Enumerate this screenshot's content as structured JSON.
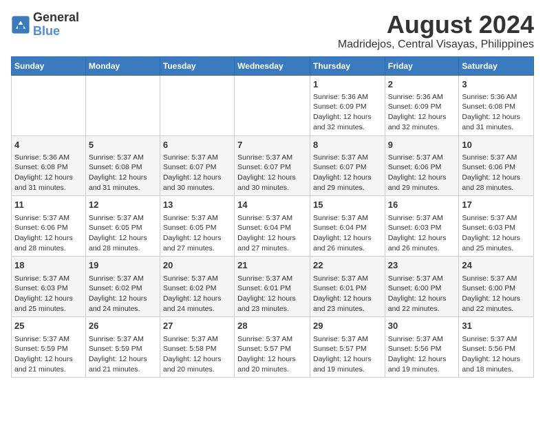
{
  "logo": {
    "line1": "General",
    "line2": "Blue"
  },
  "title": "August 2024",
  "subtitle": "Madridejos, Central Visayas, Philippines",
  "weekdays": [
    "Sunday",
    "Monday",
    "Tuesday",
    "Wednesday",
    "Thursday",
    "Friday",
    "Saturday"
  ],
  "weeks": [
    [
      {
        "day": "",
        "info": ""
      },
      {
        "day": "",
        "info": ""
      },
      {
        "day": "",
        "info": ""
      },
      {
        "day": "",
        "info": ""
      },
      {
        "day": "1",
        "info": "Sunrise: 5:36 AM\nSunset: 6:09 PM\nDaylight: 12 hours\nand 32 minutes."
      },
      {
        "day": "2",
        "info": "Sunrise: 5:36 AM\nSunset: 6:09 PM\nDaylight: 12 hours\nand 32 minutes."
      },
      {
        "day": "3",
        "info": "Sunrise: 5:36 AM\nSunset: 6:08 PM\nDaylight: 12 hours\nand 31 minutes."
      }
    ],
    [
      {
        "day": "4",
        "info": "Sunrise: 5:36 AM\nSunset: 6:08 PM\nDaylight: 12 hours\nand 31 minutes."
      },
      {
        "day": "5",
        "info": "Sunrise: 5:37 AM\nSunset: 6:08 PM\nDaylight: 12 hours\nand 31 minutes."
      },
      {
        "day": "6",
        "info": "Sunrise: 5:37 AM\nSunset: 6:07 PM\nDaylight: 12 hours\nand 30 minutes."
      },
      {
        "day": "7",
        "info": "Sunrise: 5:37 AM\nSunset: 6:07 PM\nDaylight: 12 hours\nand 30 minutes."
      },
      {
        "day": "8",
        "info": "Sunrise: 5:37 AM\nSunset: 6:07 PM\nDaylight: 12 hours\nand 29 minutes."
      },
      {
        "day": "9",
        "info": "Sunrise: 5:37 AM\nSunset: 6:06 PM\nDaylight: 12 hours\nand 29 minutes."
      },
      {
        "day": "10",
        "info": "Sunrise: 5:37 AM\nSunset: 6:06 PM\nDaylight: 12 hours\nand 28 minutes."
      }
    ],
    [
      {
        "day": "11",
        "info": "Sunrise: 5:37 AM\nSunset: 6:06 PM\nDaylight: 12 hours\nand 28 minutes."
      },
      {
        "day": "12",
        "info": "Sunrise: 5:37 AM\nSunset: 6:05 PM\nDaylight: 12 hours\nand 28 minutes."
      },
      {
        "day": "13",
        "info": "Sunrise: 5:37 AM\nSunset: 6:05 PM\nDaylight: 12 hours\nand 27 minutes."
      },
      {
        "day": "14",
        "info": "Sunrise: 5:37 AM\nSunset: 6:04 PM\nDaylight: 12 hours\nand 27 minutes."
      },
      {
        "day": "15",
        "info": "Sunrise: 5:37 AM\nSunset: 6:04 PM\nDaylight: 12 hours\nand 26 minutes."
      },
      {
        "day": "16",
        "info": "Sunrise: 5:37 AM\nSunset: 6:03 PM\nDaylight: 12 hours\nand 26 minutes."
      },
      {
        "day": "17",
        "info": "Sunrise: 5:37 AM\nSunset: 6:03 PM\nDaylight: 12 hours\nand 25 minutes."
      }
    ],
    [
      {
        "day": "18",
        "info": "Sunrise: 5:37 AM\nSunset: 6:03 PM\nDaylight: 12 hours\nand 25 minutes."
      },
      {
        "day": "19",
        "info": "Sunrise: 5:37 AM\nSunset: 6:02 PM\nDaylight: 12 hours\nand 24 minutes."
      },
      {
        "day": "20",
        "info": "Sunrise: 5:37 AM\nSunset: 6:02 PM\nDaylight: 12 hours\nand 24 minutes."
      },
      {
        "day": "21",
        "info": "Sunrise: 5:37 AM\nSunset: 6:01 PM\nDaylight: 12 hours\nand 23 minutes."
      },
      {
        "day": "22",
        "info": "Sunrise: 5:37 AM\nSunset: 6:01 PM\nDaylight: 12 hours\nand 23 minutes."
      },
      {
        "day": "23",
        "info": "Sunrise: 5:37 AM\nSunset: 6:00 PM\nDaylight: 12 hours\nand 22 minutes."
      },
      {
        "day": "24",
        "info": "Sunrise: 5:37 AM\nSunset: 6:00 PM\nDaylight: 12 hours\nand 22 minutes."
      }
    ],
    [
      {
        "day": "25",
        "info": "Sunrise: 5:37 AM\nSunset: 5:59 PM\nDaylight: 12 hours\nand 21 minutes."
      },
      {
        "day": "26",
        "info": "Sunrise: 5:37 AM\nSunset: 5:59 PM\nDaylight: 12 hours\nand 21 minutes."
      },
      {
        "day": "27",
        "info": "Sunrise: 5:37 AM\nSunset: 5:58 PM\nDaylight: 12 hours\nand 20 minutes."
      },
      {
        "day": "28",
        "info": "Sunrise: 5:37 AM\nSunset: 5:57 PM\nDaylight: 12 hours\nand 20 minutes."
      },
      {
        "day": "29",
        "info": "Sunrise: 5:37 AM\nSunset: 5:57 PM\nDaylight: 12 hours\nand 19 minutes."
      },
      {
        "day": "30",
        "info": "Sunrise: 5:37 AM\nSunset: 5:56 PM\nDaylight: 12 hours\nand 19 minutes."
      },
      {
        "day": "31",
        "info": "Sunrise: 5:37 AM\nSunset: 5:56 PM\nDaylight: 12 hours\nand 18 minutes."
      }
    ]
  ]
}
